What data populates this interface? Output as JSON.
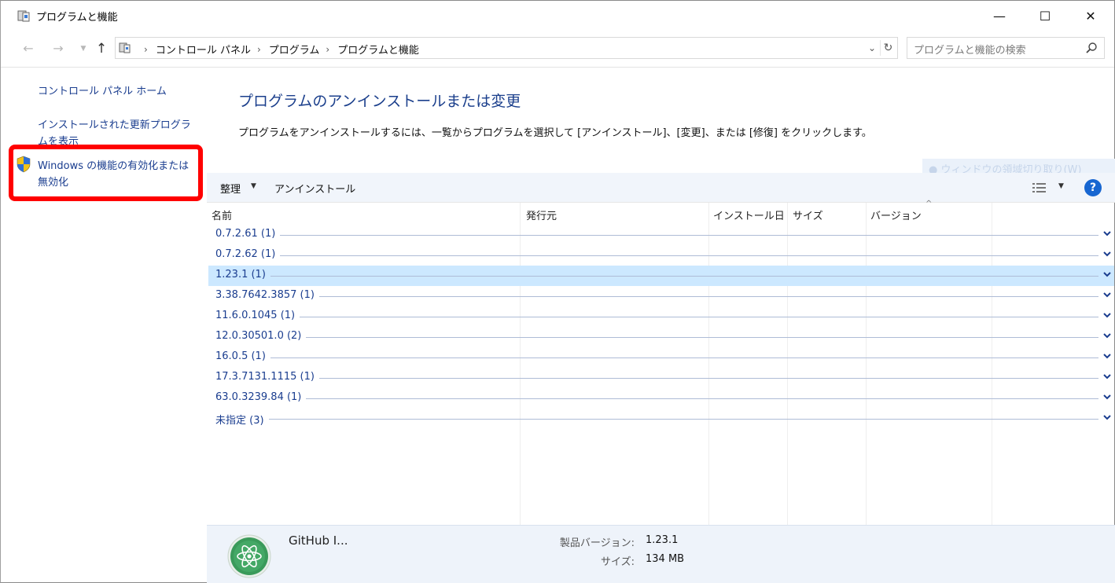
{
  "window": {
    "title": "プログラムと機能",
    "minimize_glyph": "—",
    "maximize_glyph": "☐",
    "close_glyph": "✕"
  },
  "nav": {
    "back_glyph": "←",
    "forward_glyph": "→",
    "up_glyph": "↑",
    "breadcrumbs": [
      "コントロール パネル",
      "プログラム",
      "プログラムと機能"
    ],
    "search_placeholder": "プログラムと機能の検索"
  },
  "sidebar": {
    "home_link": "コントロール パネル ホーム",
    "updates_link": "インストールされた更新プログラムを表示",
    "features_link": "Windows の機能の有効化または無効化"
  },
  "main": {
    "title": "プログラムのアンインストールまたは変更",
    "description": "プログラムをアンインストールするには、一覧からプログラムを選択して [アンインストール]、[変更]、または [修復] をクリックします。",
    "ghost_tooltip": "ウィンドウの領域切り取り(W)"
  },
  "toolbar": {
    "organize_label": "整理",
    "uninstall_label": "アンインストール",
    "help_label": "?"
  },
  "table": {
    "columns": [
      "名前",
      "発行元",
      "インストール日",
      "サイズ",
      "バージョン"
    ],
    "groups": [
      {
        "label": "0.7.2.61 (1)",
        "selected": false
      },
      {
        "label": "0.7.2.62 (1)",
        "selected": false
      },
      {
        "label": "1.23.1 (1)",
        "selected": true
      },
      {
        "label": "3.38.7642.3857 (1)",
        "selected": false
      },
      {
        "label": "11.6.0.1045 (1)",
        "selected": false
      },
      {
        "label": "12.0.30501.0 (2)",
        "selected": false
      },
      {
        "label": "16.0.5 (1)",
        "selected": false
      },
      {
        "label": "17.3.7131.1115 (1)",
        "selected": false
      },
      {
        "label": "63.0.3239.84 (1)",
        "selected": false
      },
      {
        "label": "未指定 (3)",
        "selected": false
      }
    ]
  },
  "details": {
    "app_name": "GitHub I...",
    "version_label": "製品バージョン:",
    "version_value": "1.23.1",
    "size_label": "サイズ:",
    "size_value": "134 MB"
  },
  "colors": {
    "link_blue": "#1a3d8f",
    "title_blue": "#1b3f8c",
    "selection": "#cce8ff",
    "highlight_red": "#ff0000",
    "toolbar_bg": "#f1f5fb",
    "details_bg": "#eef3fa",
    "atom_green": "#3a9a5a"
  }
}
